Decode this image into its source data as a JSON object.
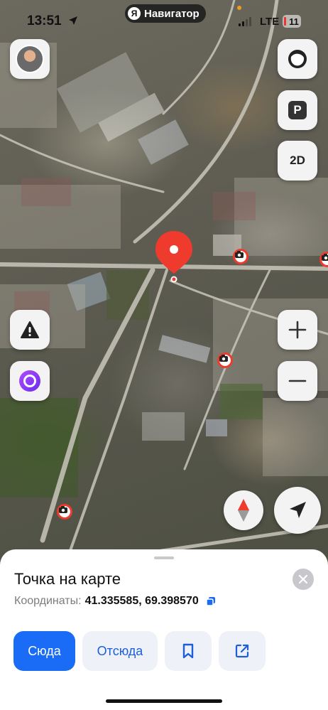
{
  "status_bar": {
    "time": "13:51",
    "network": "LTE",
    "battery": "11",
    "location_icon": "location-arrow-icon"
  },
  "app": {
    "logo_letter": "Я",
    "name": "Навигатор"
  },
  "map_controls": {
    "left": [
      "avatar",
      "alert-icon",
      "alice-icon"
    ],
    "right": [
      "layers-icon",
      "parking-icon",
      "2d-mode",
      "zoom-in-icon",
      "zoom-out-icon"
    ],
    "mode_label": "2D",
    "parking_label": "P",
    "bottom": [
      "compass-icon",
      "locate-icon"
    ]
  },
  "map": {
    "pin_icon": "map-pin-icon",
    "camera_icon": "speed-camera-icon"
  },
  "sheet": {
    "title": "Точка на карте",
    "coords_label": "Координаты:",
    "coords_value": "41.335585, 69.398570",
    "actions": {
      "here": "Сюда",
      "from": "Отсюда",
      "save_icon": "bookmark-icon",
      "share_icon": "share-icon"
    }
  },
  "colors": {
    "accent_blue": "#1a6cf6",
    "pin_red": "#ee3b2e",
    "secondary_button": "#eef1f7"
  }
}
